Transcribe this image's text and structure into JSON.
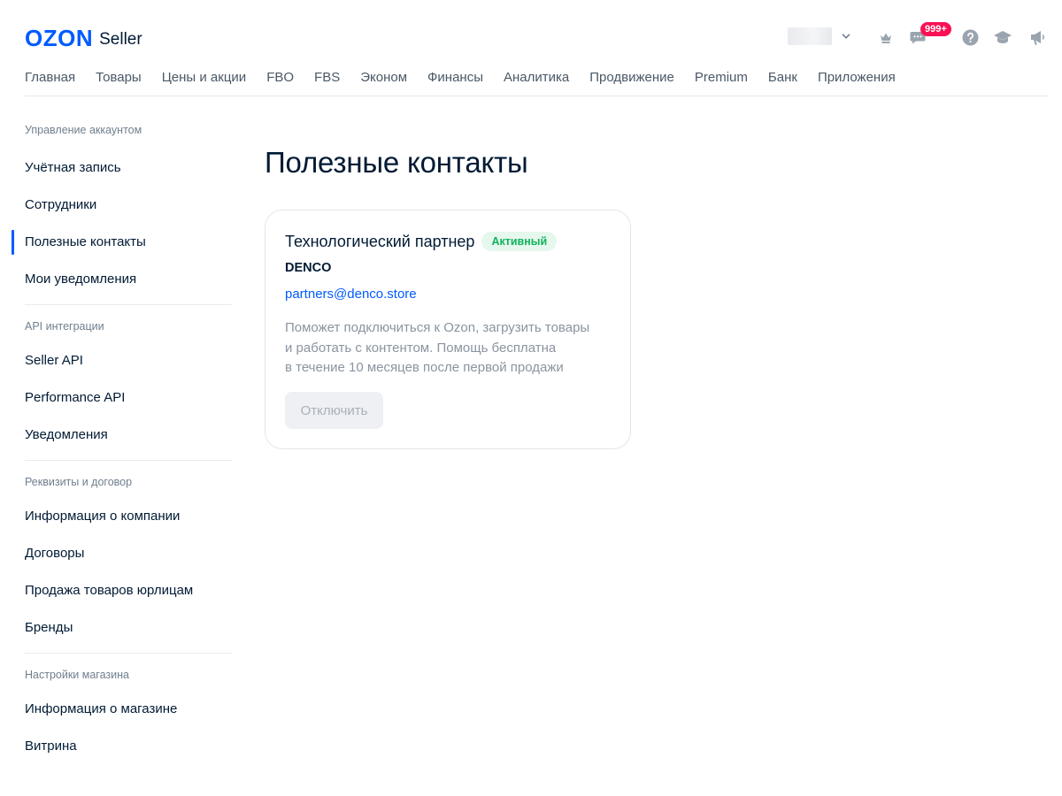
{
  "brand": {
    "name": "OZON",
    "product": "Seller"
  },
  "header": {
    "notifications_badge": "999+",
    "icons": [
      "chevron-down-icon",
      "crown-icon",
      "chat-icon",
      "help-icon",
      "graduation-cap-icon",
      "megaphone-icon"
    ]
  },
  "topnav": {
    "items": [
      "Главная",
      "Товары",
      "Цены и акции",
      "FBO",
      "FBS",
      "Эконом",
      "Финансы",
      "Аналитика",
      "Продвижение",
      "Premium",
      "Банк",
      "Приложения"
    ]
  },
  "sidebar": {
    "groups": [
      {
        "title": "Управление аккаунтом",
        "items": [
          "Учётная запись",
          "Сотрудники",
          "Полезные контакты",
          "Мои уведомления"
        ]
      },
      {
        "title": "API интеграции",
        "items": [
          "Seller API",
          "Performance API",
          "Уведомления"
        ]
      },
      {
        "title": "Реквизиты и договор",
        "items": [
          "Информация о компании",
          "Договоры",
          "Продажа товаров юрлицам",
          "Бренды"
        ]
      },
      {
        "title": "Настройки магазина",
        "items": [
          "Информация о магазине",
          "Витрина"
        ]
      }
    ],
    "active_item": "Полезные контакты"
  },
  "page": {
    "title": "Полезные контакты",
    "card": {
      "title": "Технологический партнер",
      "status": "Активный",
      "partner_name": "DENCO",
      "email": "partners@denco.store",
      "description": [
        "Поможет подключиться к Ozon, загрузить товары",
        "и работать с контентом. Помощь бесплатна",
        "в течение 10 месяцев после первой продажи"
      ],
      "button_label": "Отключить"
    }
  },
  "colors": {
    "brand_blue": "#005bff",
    "text_primary": "#001a34",
    "text_secondary": "#707f8d",
    "status_green": "#10b35c",
    "badge_red": "#f91155"
  }
}
